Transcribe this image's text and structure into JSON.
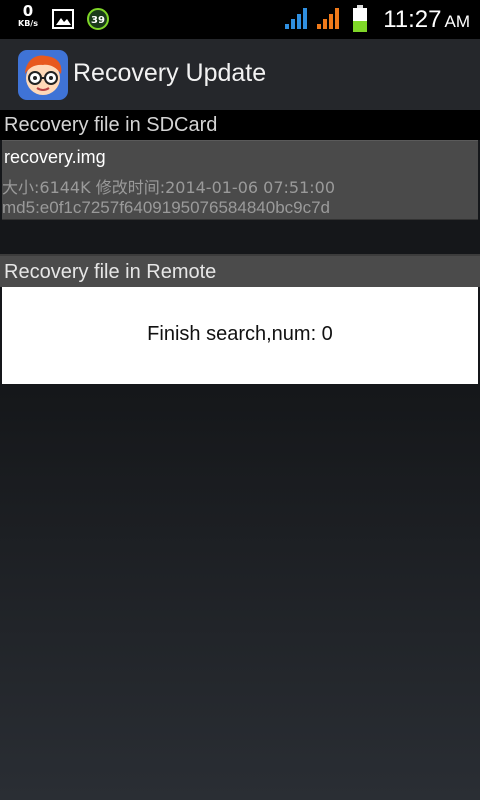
{
  "status_bar": {
    "speed_value": "0",
    "speed_unit": "KB/s",
    "badge_number": "39",
    "time": "11:27",
    "ampm": "AM",
    "colors": {
      "signal1": "#2f8fe0",
      "signal2": "#f07a1a",
      "battery": "#7fd628"
    }
  },
  "action_bar": {
    "title": "Recovery Update"
  },
  "sections": {
    "sdcard_header": "Recovery file in SDCard",
    "remote_header": "Recovery file in Remote"
  },
  "sdcard_file": {
    "name": "recovery.img",
    "meta": "大小:6144K 修改时间:2014-01-06 07:51:00",
    "md5": "md5:e0f1c7257f6409195076584840bc9c7d"
  },
  "remote": {
    "status": "Finish search,num: 0"
  }
}
